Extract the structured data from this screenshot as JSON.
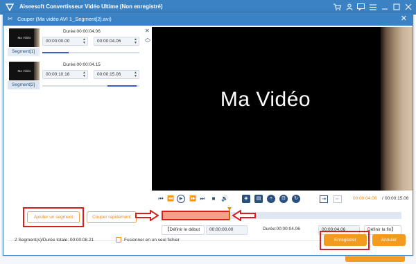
{
  "app": {
    "title": "Aiseesoft Convertisseur Vidéo Ultime (Non enregistré)",
    "icons": [
      "cart-icon",
      "user-icon",
      "chat-icon",
      "menu-icon",
      "minimize-icon",
      "maximize-icon",
      "close-icon"
    ]
  },
  "dialog": {
    "title": "Couper (Ma vidéo AVI 1_Segment[2].avi)"
  },
  "segments": [
    {
      "label": "Segment[1]",
      "thumb_text": "Ma Vidéo",
      "duration": "Durée:00:00:04.06",
      "start": "00:00:00.00",
      "end": "00:00:04.06",
      "track_fill": 0.27
    },
    {
      "label": "Segment[2]",
      "thumb_text": "Ma Vidéo",
      "duration": "Durée:00:00:04.15",
      "start": "00:00:10.16",
      "end": "00:00:15.06",
      "track_fill_start": 0.67,
      "track_fill_end": 0.97
    }
  ],
  "left_buttons": {
    "add_segment": "Ajouter un segment",
    "quick_split": "Couper rapidement"
  },
  "preview": {
    "text": "Ma Vidéo"
  },
  "player": {
    "current_time": "00:00:04.06",
    "separator": "/",
    "total_time": "00:00:15.06"
  },
  "timeline": {
    "selection_start": 0.0,
    "selection_end": 0.28
  },
  "trim": {
    "set_start": "Définir le début",
    "start_value": "00:00:00.00",
    "duration": "Durée:00:00:04.06",
    "end_value": "00:00:04.06",
    "set_end": "Définir la fin"
  },
  "footer": {
    "summary": "2 Segment(s)/Durée totale: 00:00:08.21",
    "merge_label": "Fusionner en un seul fichier",
    "save": "Enregistrer",
    "cancel": "Annuler"
  },
  "colors": {
    "titlebar": "#3b82c4",
    "accent": "#f39b1e",
    "highlight": "#d91e1e",
    "selection": "#f3a28a"
  }
}
